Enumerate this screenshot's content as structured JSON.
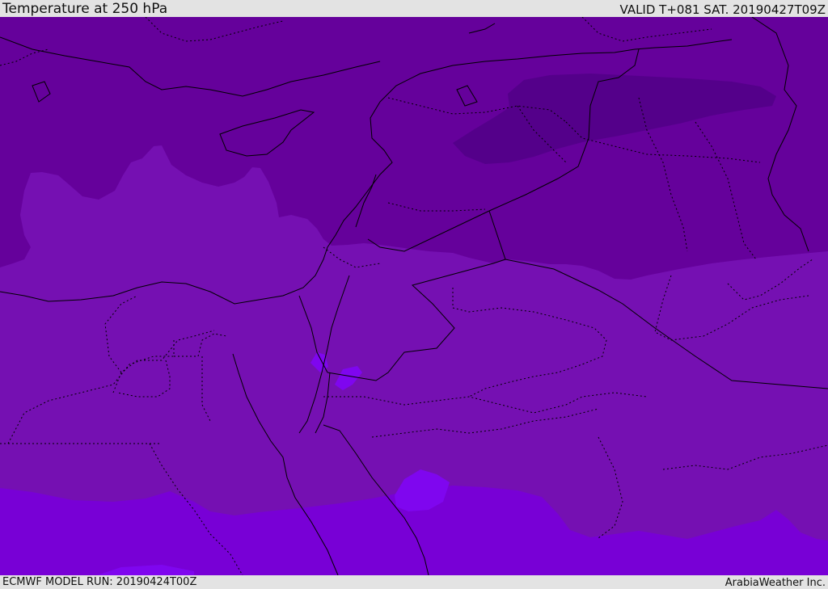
{
  "header": {
    "title": "Temperature at 250 hPa",
    "valid_time": "VALID T+081 SAT. 20190427T09Z"
  },
  "footer": {
    "model_run": "ECMWF MODEL RUN: 20190424T00Z",
    "credit": "ArabiaWeather Inc."
  },
  "map": {
    "region": "Eastern Mediterranean, Egypt, Levant, Iraq, northern Saudi Arabia",
    "colors": {
      "coldest_core": "#54008a",
      "cold": "#65019b",
      "mid": "#7510b2",
      "warm": "#7800d6",
      "warm_patch": "#7f06ef",
      "border": "#000000"
    }
  }
}
